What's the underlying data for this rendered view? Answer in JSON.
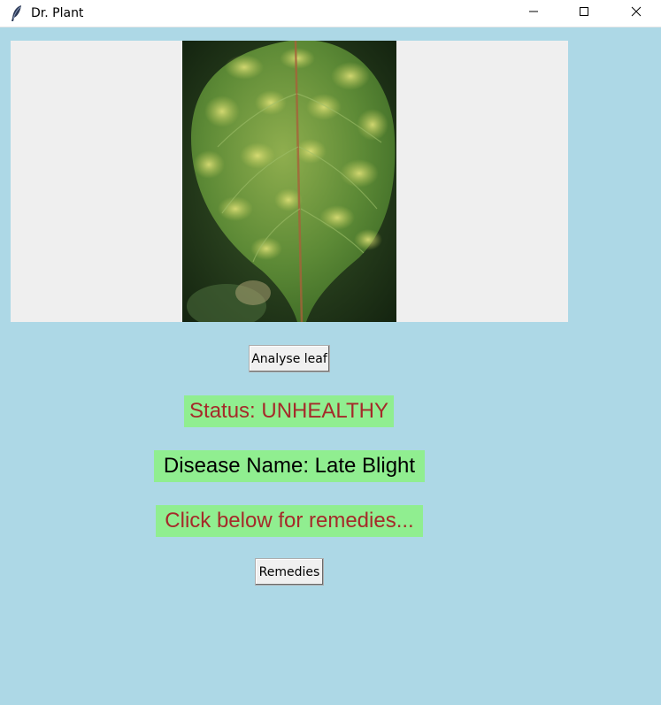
{
  "window": {
    "title": "Dr. Plant"
  },
  "main": {
    "analyse_label": "Analyse leaf",
    "status_text": "Status: UNHEALTHY",
    "disease_text": "Disease Name: Late Blight",
    "prompt_text": "Click below for remedies...",
    "remedies_label": "Remedies"
  },
  "colors": {
    "background": "#add8e6",
    "label_bg": "#90ee90",
    "status_fg": "#a52a2a",
    "canvas_bg": "#efefef"
  },
  "icons": [
    "feather-icon",
    "minimize-icon",
    "maximize-icon",
    "close-icon"
  ]
}
